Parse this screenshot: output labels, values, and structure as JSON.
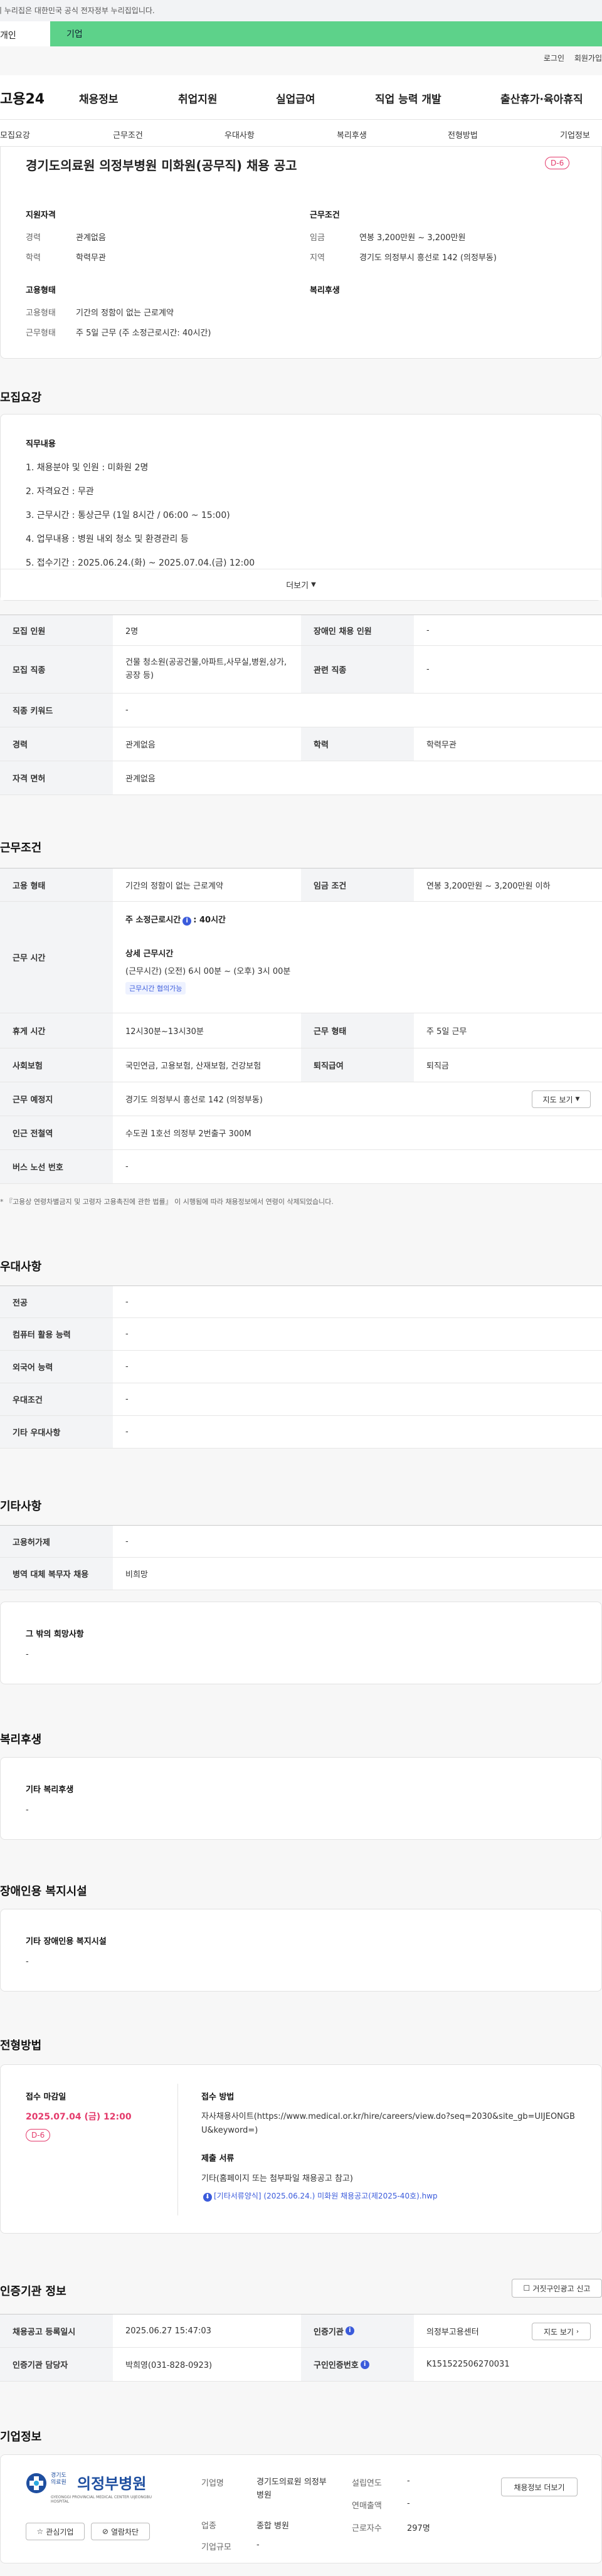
{
  "gov_notice": "이 누리집은 대한민국 공식 전자정부 누리집입니다.",
  "tabs": {
    "left": "개인",
    "right": "기업"
  },
  "util": {
    "login": "로그인",
    "join": "회원가입"
  },
  "brand": "고용24",
  "nav": [
    "채용정보",
    "취업지원",
    "실업급여",
    "직업 능력 개발",
    "출산휴가·육아휴직"
  ],
  "anchors": [
    "모집요강",
    "근무조건",
    "우대사항",
    "복리후생",
    "전형방법",
    "기업정보"
  ],
  "header": {
    "title": "경기도의료원 의정부병원 미화원(공무직) 채용 공고",
    "dday": "D-6",
    "qual_h": "지원자격",
    "cond_h": "근무조건",
    "career_l": "경력",
    "career_v": "관계없음",
    "edu_l": "학력",
    "edu_v": "학력무관",
    "wage_l": "임금",
    "wage_v": "연봉 3,200만원 ~ 3,200만원",
    "region_l": "지역",
    "region_v": "경기도 의정부시 흥선로 142 (의정부동)",
    "emp_h": "고용형태",
    "welfare_h": "복리후생",
    "emptype_l": "고용형태",
    "emptype_v": "기간의 정함이 없는 근로계약",
    "worktype_l": "근무형태",
    "worktype_v": "주 5일 근무 (주 소정근로시간: 40시간)"
  },
  "recruit": {
    "h": "모집요강",
    "duty_h": "직무내용",
    "duties": [
      "1. 채용분야 및 인원 : 미화원 2명",
      "2. 자격요건 : 무관",
      "3. 근무시간 : 통상근무 (1일 8시간 / 06:00 ~ 15:00)",
      "4. 업무내용 : 병원 내외 청소 및 환경관리 등",
      "5. 접수기간 : 2025.06.24.(화) ~ 2025.07.04.(금) 12:00"
    ],
    "more": "더보기",
    "rows": [
      {
        "k1": "모집 인원",
        "v1": "2명",
        "k2": "장애인 채용 인원",
        "v2": "-"
      },
      {
        "k1": "모집 직종",
        "v1": "건물 청소원(공공건물,아파트,사무실,병원,상가,공장 등)",
        "k2": "관련 직종",
        "v2": "-"
      },
      {
        "k1": "직종 키워드",
        "v1": "-"
      },
      {
        "k1": "경력",
        "v1": "관계없음",
        "k2": "학력",
        "v2": "학력무관"
      },
      {
        "k1": "자격 면허",
        "v1": "관계없음"
      }
    ]
  },
  "workcond": {
    "h": "근무조건",
    "emptype_k": "고용 형태",
    "emptype_v": "기간의 정함이 없는 근로계약",
    "wage_k": "임금 조건",
    "wage_v": "연봉 3,200만원 ~ 3,200만원 이하",
    "time_k": "근무 시간",
    "time_total": "주 소정근로시간",
    "time_total_v": ": 40시간",
    "time_detail_h": "상세 근무시간",
    "time_detail_v": "(근무시간) (오전) 6시 00분 ~ (오후) 3시 00분",
    "time_tag": "근무시간 협의가능",
    "rest_k": "휴게 시간",
    "rest_v": "12시30분~13시30분",
    "form_k": "근무 형태",
    "form_v": "주 5일 근무",
    "ins_k": "사회보험",
    "ins_v": "국민연금, 고용보험, 산재보험, 건강보험",
    "sev_k": "퇴직급여",
    "sev_v": "퇴직금",
    "place_k": "근무 예정지",
    "place_v": "경기도 의정부시 흥선로 142 (의정부동)",
    "map_btn": "지도 보기",
    "subway_k": "인근 전철역",
    "subway_v": "수도권 1호선 의정부 2번출구 300M",
    "bus_k": "버스 노선 번호",
    "bus_v": "-",
    "note": "* 『고용상 연령차별금지 및 고령자 고용촉진에 관한 법률』 이 시행됨에 따라 채용정보에서 연령이 삭제되었습니다."
  },
  "pref": {
    "h": "우대사항",
    "rows": [
      {
        "k": "전공",
        "v": "-"
      },
      {
        "k": "컴퓨터 활용 능력",
        "v": "-"
      },
      {
        "k": "외국어 능력",
        "v": "-"
      },
      {
        "k": "우대조건",
        "v": "-"
      },
      {
        "k": "기타 우대사항",
        "v": "-"
      }
    ]
  },
  "other": {
    "h": "기타사항",
    "rows": [
      {
        "k": "고용허가제",
        "v": "-"
      },
      {
        "k": "병역 대체 복무자 채용",
        "v": "비희망"
      }
    ],
    "etc_h": "그 밖의 희망사항",
    "etc_v": "-"
  },
  "welfare": {
    "h": "복리후생",
    "sub_h": "기타 복리후생",
    "v": "-"
  },
  "disabled": {
    "h": "장애인용 복지시설",
    "sub_h": "기타 장애인용 복지시설",
    "v": "-"
  },
  "process": {
    "h": "전형방법",
    "deadline_h": "접수 마감일",
    "deadline_v": "2025.07.04 (금) 12:00",
    "dday": "D-6",
    "method_h": "접수 방법",
    "method_v": "자사채용사이트(https://www.medical.or.kr/hire/careers/view.do?seq=2030&site_gb=UIJEONGBU&keyword=)",
    "docs_h": "제출 서류",
    "docs_v": "기타(홈페이지 또는 첨부파일 채용공고 참고)",
    "file": "[기타서류양식] (2025.06.24.) 미화원 채용공고(제2025-40호).hwp"
  },
  "cert": {
    "h": "인증기관 정보",
    "report_btn": "거짓구인광고 신고",
    "reg_k": "채용공고 등록일시",
    "reg_v": "2025.06.27 15:47:03",
    "org_k": "인증기관",
    "org_v": "의정부고용센터",
    "map_btn": "지도 보기",
    "mgr_k": "인증기관 담당자",
    "mgr_v": "박희영(031-828-0923)",
    "no_k": "구인인증번호",
    "no_v": "K151522506270031"
  },
  "company": {
    "h": "기업정보",
    "logo_small": "경기도\n의료원",
    "logo_big": "의정부병원",
    "logo_en": "GYEONGGI PROVINCIAL MEDICAL CENTER UIJEONGBU HOSPITAL",
    "fav_btn": "관심기업",
    "block_btn": "열람차단",
    "name_k": "기업명",
    "name_v": "경기도의료원 의정부병원",
    "ind_k": "업종",
    "ind_v": "종합 병원",
    "scale_k": "기업규모",
    "scale_v": "-",
    "year_k": "설립연도",
    "year_v": "-",
    "sales_k": "연매출액",
    "sales_v": "-",
    "emp_k": "근로자수",
    "emp_v": "297명",
    "jobs_btn": "채용정보 더보기"
  }
}
